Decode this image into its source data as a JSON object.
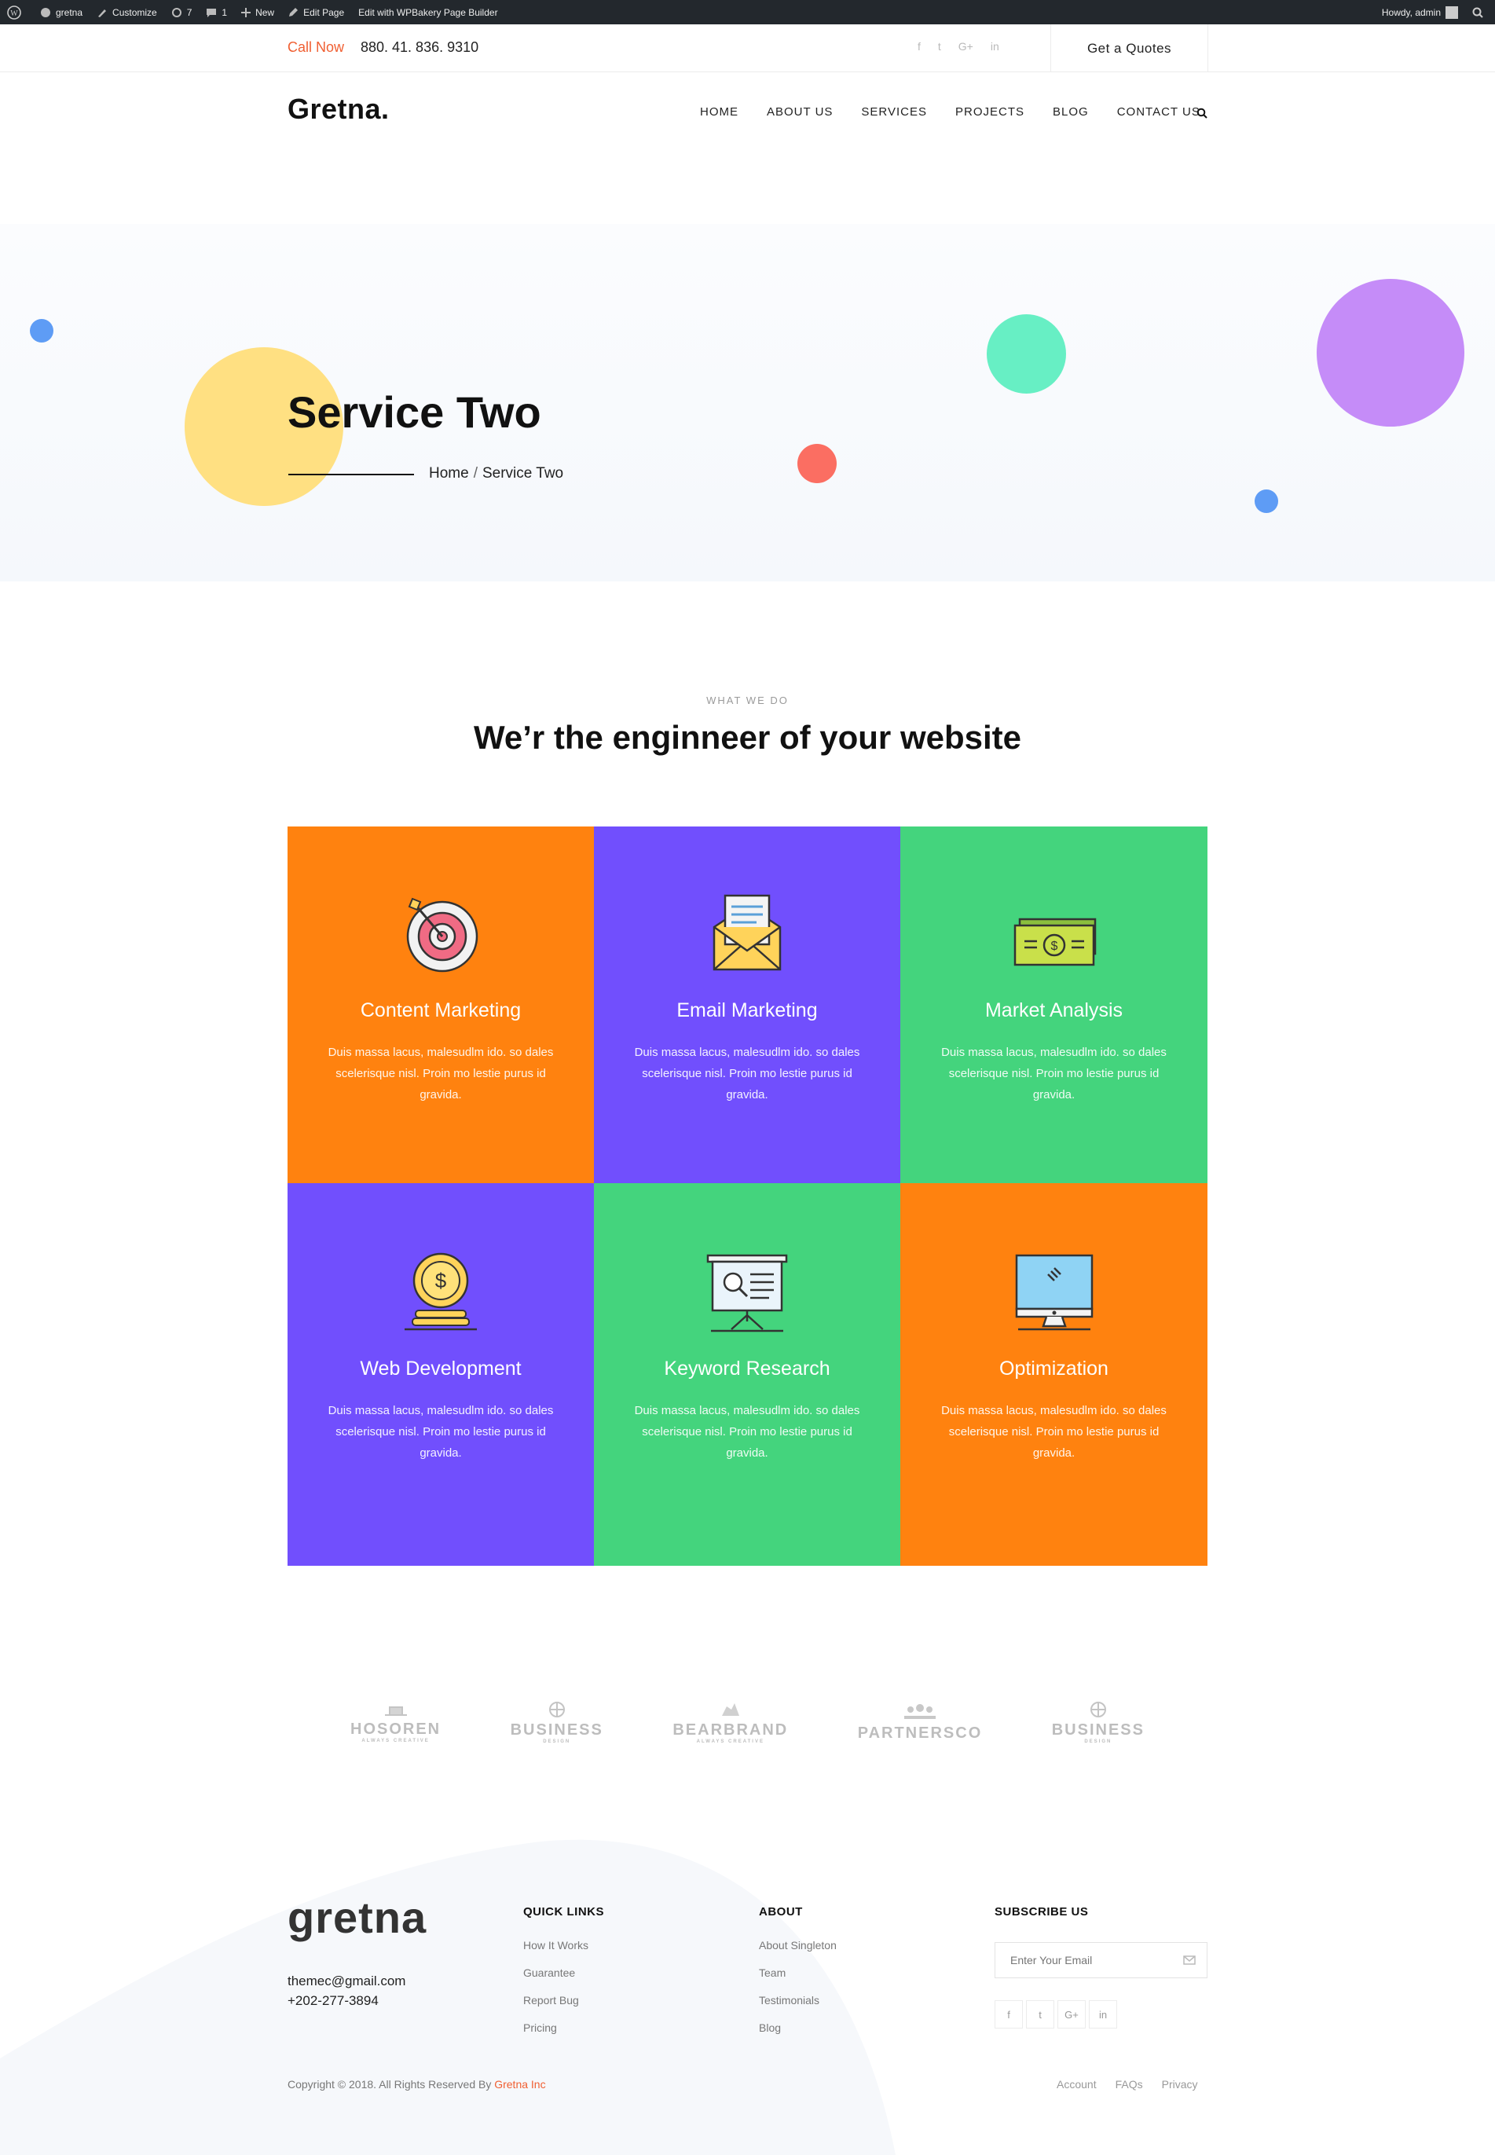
{
  "admin_bar": {
    "site_name": "gretna",
    "customize": "Customize",
    "updates_count": "7",
    "comments_count": "1",
    "new": "New",
    "edit_page": "Edit Page",
    "edit_wpbakery": "Edit with WPBakery Page Builder",
    "howdy": "Howdy, admin"
  },
  "topbar": {
    "call_label": "Call Now",
    "phone": "880. 41. 836. 9310",
    "social": [
      "f",
      "t",
      "G+",
      "in"
    ],
    "quote_button": "Get a Quotes"
  },
  "header": {
    "logo": "Gretna.",
    "nav": [
      "HOME",
      "ABOUT US",
      "SERVICES",
      "PROJECTS",
      "BLOG",
      "CONTACT US"
    ]
  },
  "hero": {
    "title": "Service Two",
    "breadcrumb_home": "Home",
    "breadcrumb_sep": "/",
    "breadcrumb_current": "Service Two"
  },
  "services_section": {
    "eyebrow": "WHAT WE DO",
    "title": "We’r the enginneer of your website",
    "cards": [
      {
        "icon": "target-icon",
        "title": "Content Marketing",
        "text": "Duis massa lacus, malesudlm ido. so dales scelerisque nisl. Proin mo lestie purus id gravida.",
        "color": "#ff820f"
      },
      {
        "icon": "envelope-icon",
        "title": "Email Marketing",
        "text": "Duis massa lacus, malesudlm ido. so dales scelerisque nisl. Proin mo lestie purus id gravida.",
        "color": "#714ffd"
      },
      {
        "icon": "money-icon",
        "title": "Market Analysis",
        "text": "Duis massa lacus, malesudlm ido. so dales scelerisque nisl. Proin mo lestie purus id gravida.",
        "color": "#44d47d"
      },
      {
        "icon": "coins-icon",
        "title": "Web Development",
        "text": "Duis massa lacus, malesudlm ido. so dales scelerisque nisl. Proin mo lestie purus id gravida.",
        "color": "#714ffd"
      },
      {
        "icon": "presentation-icon",
        "title": "Keyword Research",
        "text": "Duis massa lacus, malesudlm ido. so dales scelerisque nisl. Proin mo lestie purus id gravida.",
        "color": "#44d47d"
      },
      {
        "icon": "monitor-icon",
        "title": "Optimization",
        "text": "Duis massa lacus, malesudlm ido. so dales scelerisque nisl. Proin mo lestie purus id gravida.",
        "color": "#ff820f"
      }
    ]
  },
  "brands": [
    {
      "name": "HOSOREN",
      "sub": "ALWAYS CREATIVE"
    },
    {
      "name": "BUSINESS",
      "sub": "DESIGN"
    },
    {
      "name": "BEARBRAND",
      "sub": "ALWAYS CREATIVE"
    },
    {
      "name": "PARTNERSCO",
      "sub": ""
    },
    {
      "name": "BUSINESS",
      "sub": "DESIGN"
    }
  ],
  "footer": {
    "logo": "gretna",
    "email": "themec@gmail.com",
    "phone": "+202-277-3894",
    "quick_links": {
      "heading": "QUICK LINKS",
      "items": [
        "How It Works",
        "Guarantee",
        "Report Bug",
        "Pricing"
      ]
    },
    "about": {
      "heading": "ABOUT",
      "items": [
        "About Singleton",
        "Team",
        "Testimonials",
        "Blog"
      ]
    },
    "subscribe": {
      "heading": "SUBSCRIBE US",
      "placeholder": "Enter Your Email"
    },
    "social": [
      "f",
      "t",
      "G+",
      "in"
    ],
    "copyright_prefix": "Copyright © 2018. All Rights Reserved By",
    "copyright_brand": "Gretna Inc",
    "legal": [
      "Account",
      "FAQs",
      "Privacy"
    ]
  },
  "colors": {
    "accent": "#f05f32",
    "orange": "#ff820f",
    "purple": "#714ffd",
    "green": "#44d47d"
  }
}
